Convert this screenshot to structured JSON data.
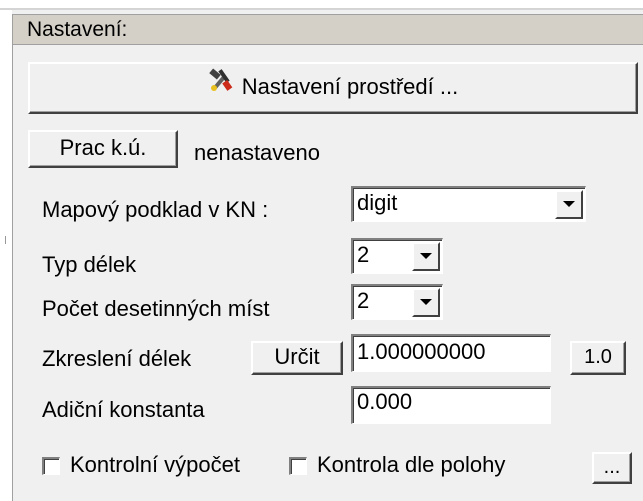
{
  "panel": {
    "title": "Nastavení:"
  },
  "environment_button": {
    "label": "Nastavení prostředí ...",
    "icon": "tools-icon"
  },
  "work_area": {
    "button_label": "Prac k.ú.",
    "value": "nenastaveno"
  },
  "fields": {
    "map_base": {
      "label": "Mapový podklad v KN :",
      "value": "digit"
    },
    "length_type": {
      "label": "Typ délek",
      "value": "2"
    },
    "decimal_places": {
      "label": "Počet desetinných míst",
      "value": "2"
    },
    "length_distortion": {
      "label": "Zkreslení délek",
      "determine_label": "Určit",
      "value": "1.000000000",
      "reset_label": "1.0"
    },
    "additive_constant": {
      "label": "Adiční konstanta",
      "value": "0.000"
    }
  },
  "checkboxes": {
    "control_calc": {
      "label": "Kontrolní výpočet",
      "checked": false
    },
    "position_check": {
      "label": "Kontrola dle polohy",
      "checked": false
    }
  },
  "ellipsis_button": {
    "label": "..."
  },
  "colors": {
    "panel_bg": "#f0f0f0",
    "title_bg": "#d4d0c8",
    "field_bg": "#ffffff"
  }
}
